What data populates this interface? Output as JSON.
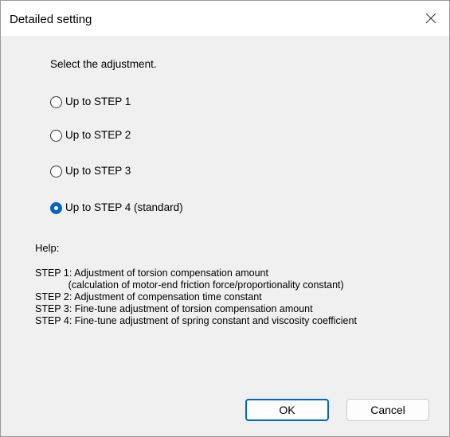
{
  "dialog": {
    "title": "Detailed setting",
    "close_icon": "close-icon"
  },
  "prompt": "Select the adjustment.",
  "options": [
    {
      "label": "Up to STEP 1",
      "selected": false
    },
    {
      "label": "Up to STEP 2",
      "selected": false
    },
    {
      "label": "Up to STEP 3",
      "selected": false
    },
    {
      "label": "Up to STEP 4 (standard)",
      "selected": true
    }
  ],
  "help": {
    "title": "Help:",
    "lines": [
      "STEP 1: Adjustment of torsion compensation amount",
      "            (calculation of motor-end friction force/proportionality constant)",
      "STEP 2: Adjustment of compensation time constant",
      "STEP 3: Fine-tune adjustment of torsion compensation amount",
      "STEP 4: Fine-tune adjustment of spring constant and viscosity coefficient"
    ]
  },
  "buttons": {
    "ok_label": "OK",
    "cancel_label": "Cancel"
  },
  "colors": {
    "accent": "#0067c0",
    "window_bg": "#f0f0f0",
    "titlebar_bg": "#ffffff"
  }
}
